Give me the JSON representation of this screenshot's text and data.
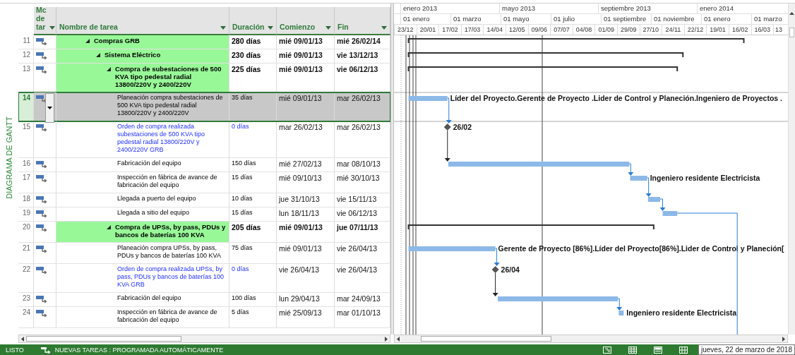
{
  "side_label": "DIAGRAMA DE GANTT",
  "columns": [
    {
      "label": "Mc de tar"
    },
    {
      "label": "Nombre de tarea"
    },
    {
      "label": "Duración"
    },
    {
      "label": "Comienzo"
    },
    {
      "label": "Fin"
    }
  ],
  "timescale": {
    "years": [
      "enero 2013",
      "mayo 2013",
      "septiembre 2013",
      "enero 2014"
    ],
    "months": [
      "01 enero",
      "01 marzo",
      "01 mayo",
      "01 julio",
      "01 septiembre",
      "01 noviembre",
      "01 enero",
      "01 marzo"
    ],
    "weeks": [
      "23/12",
      "20/01",
      "17/02",
      "17/03",
      "14/04",
      "12/05",
      "09/06",
      "07/07",
      "04/08",
      "01/09",
      "29/09",
      "27/10",
      "24/11",
      "22/12",
      "19/01",
      "16/02",
      "16/03",
      "13"
    ]
  },
  "tasks": [
    {
      "id": "11",
      "kind": "summary",
      "name": "Compras GRB",
      "duration": "280 días",
      "start": "mié 09/01/13",
      "finish": "mié 26/02/14",
      "selected": false,
      "children": [
        {
          "id": "12",
          "kind": "summary",
          "name": "Sistema Eléctrico",
          "duration": "230 días",
          "start": "mié 09/01/13",
          "finish": "vie 13/12/13",
          "selected": false,
          "children": [
            {
              "id": "13",
              "kind": "summary",
              "name": "Compra de subestaciones de 500 KVA tipo pedestal radial 13800/220V y 2400/220V",
              "duration": "225 días",
              "start": "mié 09/01/13",
              "finish": "vie 06/12/13",
              "selected": false,
              "children": [
                {
                  "id": "14",
                  "kind": "task",
                  "name": "Planeación compra subestaciones de 500 KVA tipo pedestal radial 13800/220V y 2400/220V",
                  "duration": "35 días",
                  "start": "mié 09/01/13",
                  "finish": "mar 26/02/13",
                  "selected": true,
                  "bar_label": "Líder del Proyecto.Gerente de Proyecto .Lider de Control y Planeción.Ingeniero de Proyectos .",
                  "linked": true
                },
                {
                  "id": "15",
                  "kind": "milestone",
                  "name": "Orden de compra realizada subestaciones de 500 KVA tipo pedestal radial 13800/220V y 2400/220V GRB",
                  "duration": "0 días",
                  "start": "mar 26/02/13",
                  "finish": "mar 26/02/13",
                  "selected": false,
                  "bar_label": "26/02",
                  "linked": true
                },
                {
                  "id": "16",
                  "kind": "task",
                  "name": "Fabricación del equipo",
                  "duration": "150 días",
                  "start": "mié 27/02/13",
                  "finish": "mar 08/10/13",
                  "selected": false,
                  "linked": true
                },
                {
                  "id": "17",
                  "kind": "task",
                  "name": "Inspección en fábrica de avance de fabricación del equipo",
                  "duration": "15 días",
                  "start": "mié 09/10/13",
                  "finish": "mié 30/10/13",
                  "selected": false,
                  "bar_label": "Ingeniero residente Electricista",
                  "linked": true
                },
                {
                  "id": "18",
                  "kind": "task",
                  "name": "Llegada a puerto del equipo",
                  "duration": "10 días",
                  "start": "jue 31/10/13",
                  "finish": "vie 15/11/13",
                  "selected": false,
                  "linked": true
                },
                {
                  "id": "19",
                  "kind": "task",
                  "name": "Llegada a sitio del equipo",
                  "duration": "15 días",
                  "start": "lun 18/11/13",
                  "finish": "vie 06/12/13",
                  "selected": false,
                  "linked": true,
                  "successor_offscreen": true
                }
              ]
            },
            {
              "id": "20",
              "kind": "summary",
              "name": "Compra de UPSs, by pass, PDUs y bancos de baterías 100 KVA",
              "duration": "205 días",
              "start": "mié 09/01/13",
              "finish": "jue 07/11/13",
              "selected": false,
              "children": [
                {
                  "id": "21",
                  "kind": "task",
                  "name": "Planeación compra UPSs, by pass, PDUs y bancos de baterías 100 KVA",
                  "duration": "75 días",
                  "start": "mié 09/01/13",
                  "finish": "vie 26/04/13",
                  "selected": false,
                  "bar_label": "Gerente de Proyecto [86%].Líder del Proyecto[86%].Lider de Control y Planeción[",
                  "linked": true
                },
                {
                  "id": "22",
                  "kind": "milestone",
                  "name": "Orden de compra realizada UPSs, by pass, PDUs y bancos de baterías 100 KVA GRB",
                  "duration": "0 días",
                  "start": "vie 26/04/13",
                  "finish": "vie 26/04/13",
                  "selected": false,
                  "bar_label": "26/04",
                  "linked": true
                },
                {
                  "id": "23",
                  "kind": "task",
                  "name": "Fabricación del equipo",
                  "duration": "100 días",
                  "start": "lun 29/04/13",
                  "finish": "mar 24/09/13",
                  "selected": false,
                  "linked": true
                },
                {
                  "id": "24",
                  "kind": "task",
                  "name": "Inspección en fábrica de avance de fabricación del equipo",
                  "duration": "5 días",
                  "start": "mié 25/09/13",
                  "finish": "mar 01/10/13",
                  "selected": false,
                  "bar_label": "Ingeniero residente Electricista"
                }
              ]
            }
          ]
        }
      ]
    }
  ],
  "status_bar": {
    "mode": "LISTO",
    "new_tasks": "NUEVAS TAREAS : PROGRAMADA AUTOMÁTICAMENTE",
    "date_tooltip": "jueves, 22 de marzo de 2018"
  }
}
